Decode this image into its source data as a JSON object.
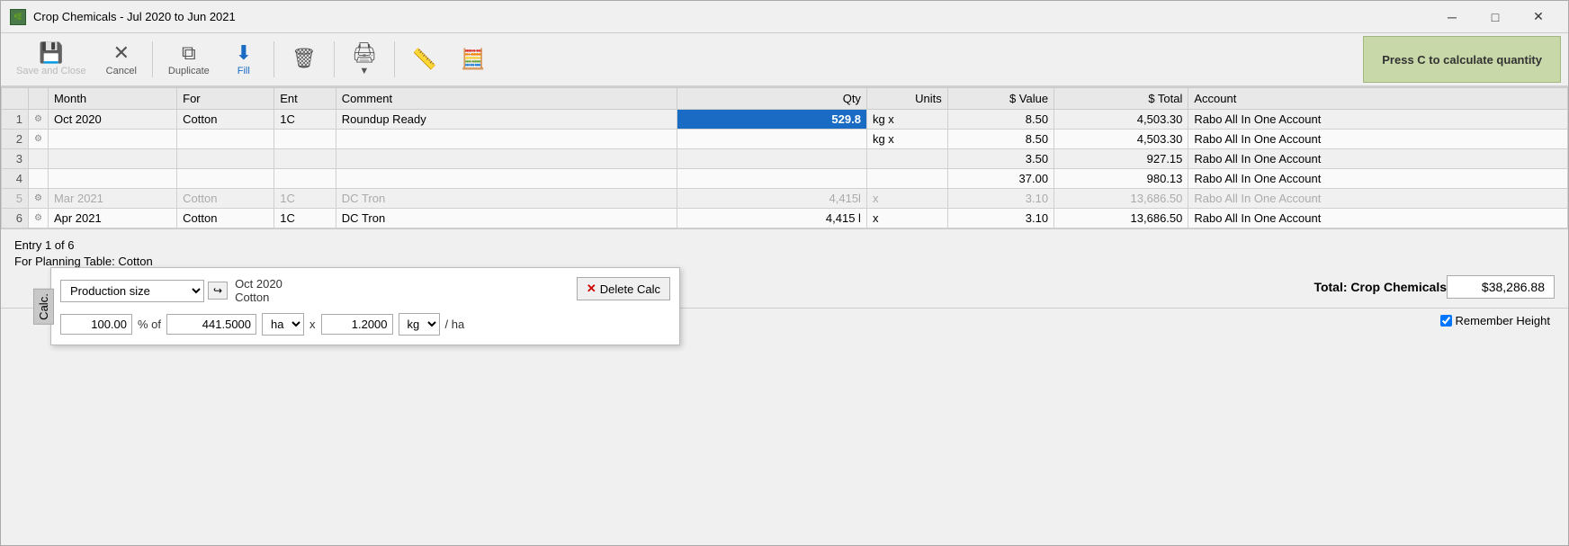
{
  "window": {
    "title": "Crop Chemicals - Jul 2020 to Jun 2021",
    "icon": "🌿"
  },
  "toolbar": {
    "save_close_label": "Save and Close",
    "cancel_label": "Cancel",
    "duplicate_label": "Duplicate",
    "fill_label": "Fill",
    "delete_label": "",
    "print_label": "",
    "calc_label": "",
    "press_c_label": "Press C to calculate quantity"
  },
  "grid": {
    "headers": [
      "Month",
      "For",
      "Ent",
      "Comment",
      "Qty",
      "Units",
      "$ Value",
      "$ Total",
      "Account"
    ],
    "rows": [
      {
        "num": "1",
        "icon": "⚙",
        "month": "Oct 2020",
        "for": "Cotton",
        "ent": "1C",
        "comment": "Roundup Ready",
        "qty": "529.8",
        "qty_highlight": true,
        "units": "kg",
        "units_x": "x",
        "value": "8.50",
        "total": "4,503.30",
        "account": "Rabo All In One Account"
      },
      {
        "num": "2",
        "icon": "⚙",
        "month": "",
        "for": "",
        "ent": "",
        "comment": "",
        "qty": "",
        "qty_highlight": false,
        "units": "kg",
        "units_x": "x",
        "value": "8.50",
        "total": "4,503.30",
        "account": "Rabo All In One Account"
      },
      {
        "num": "3",
        "icon": "",
        "month": "",
        "for": "",
        "ent": "",
        "comment": "",
        "qty": "",
        "qty_highlight": false,
        "units": "",
        "units_x": "",
        "value": "3.50",
        "total": "927.15",
        "account": "Rabo All In One Account"
      },
      {
        "num": "4",
        "icon": "",
        "month": "",
        "for": "",
        "ent": "",
        "comment": "",
        "qty": "",
        "qty_highlight": false,
        "units": "",
        "units_x": "",
        "value": "37.00",
        "total": "980.13",
        "account": "Rabo All In One Account"
      },
      {
        "num": "5",
        "icon": "⚙",
        "month": "Mar 2021",
        "for": "Cotton",
        "ent": "1C",
        "comment": "DC Tron",
        "qty": "4,415l",
        "qty_highlight": false,
        "units": "",
        "units_x": "x",
        "value": "3.10",
        "total": "13,686.50",
        "account": "Rabo All In One Account",
        "blurred": true
      },
      {
        "num": "6",
        "icon": "⚙",
        "month": "Apr 2021",
        "for": "Cotton",
        "ent": "1C",
        "comment": "DC Tron",
        "qty": "4,415 l",
        "qty_highlight": false,
        "units": "",
        "units_x": "x",
        "value": "3.10",
        "total": "13,686.50",
        "account": "Rabo All In One Account"
      }
    ]
  },
  "calc_popup": {
    "dropdown_label": "Production size",
    "context_month": "Oct 2020",
    "context_for": "Cotton",
    "delete_btn_label": "Delete Calc",
    "percent_value": "100.00",
    "percent_of_label": "% of",
    "area_value": "441.5000",
    "area_unit": "ha",
    "multiply_label": "x",
    "rate_value": "1.2000",
    "rate_unit": "kg",
    "per_ha_label": "/ ha",
    "calc_tab_label": "Calc."
  },
  "bottom": {
    "entry_info": "Entry 1 of 6",
    "planning_table": "For Planning Table: Cotton",
    "total_label": "Total: Crop Chemicals",
    "total_value": "$38,286.88",
    "remember_height_label": "Remember Height"
  },
  "titlebar": {
    "minimize": "─",
    "maximize": "□",
    "close": "✕"
  }
}
